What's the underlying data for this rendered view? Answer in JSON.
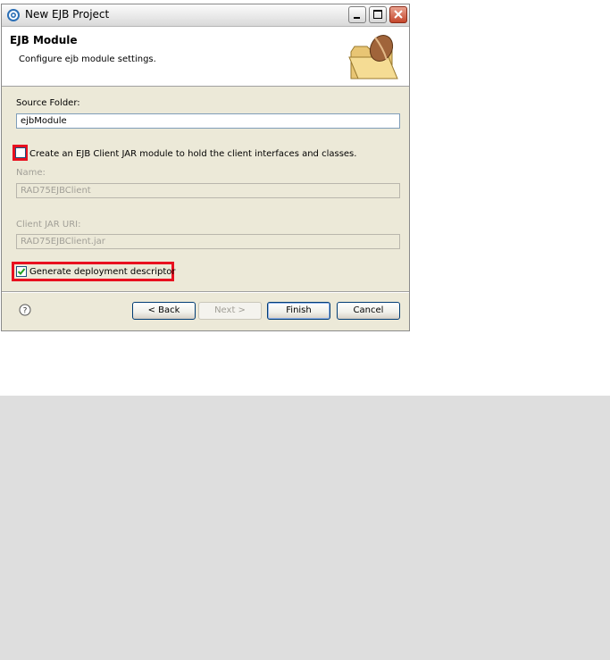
{
  "window": {
    "title": "New EJB Project"
  },
  "banner": {
    "title": "EJB Module",
    "description": "Configure ejb module settings."
  },
  "form": {
    "source_folder_label": "Source Folder:",
    "source_folder_value": "ejbModule",
    "client_jar_checkbox_label": "Create an EJB Client JAR module to hold the client interfaces and classes.",
    "client_jar_checked": false,
    "name_label": "Name:",
    "name_value": "RAD75EJBClient",
    "client_jar_uri_label": "Client JAR URI:",
    "client_jar_uri_value": "RAD75EJBClient.jar",
    "deployment_descriptor_label": "Generate deployment descriptor",
    "deployment_descriptor_checked": true
  },
  "buttons": {
    "back": "< Back",
    "next": "Next >",
    "finish": "Finish",
    "cancel": "Cancel"
  },
  "icons": {
    "app": "eclipse-icon",
    "banner": "ejb-folder-bean-icon",
    "help": "help-icon"
  },
  "colors": {
    "highlight": "#e8101f",
    "dialog_background": "#ece9d8",
    "outer_gray": "#dedede"
  }
}
